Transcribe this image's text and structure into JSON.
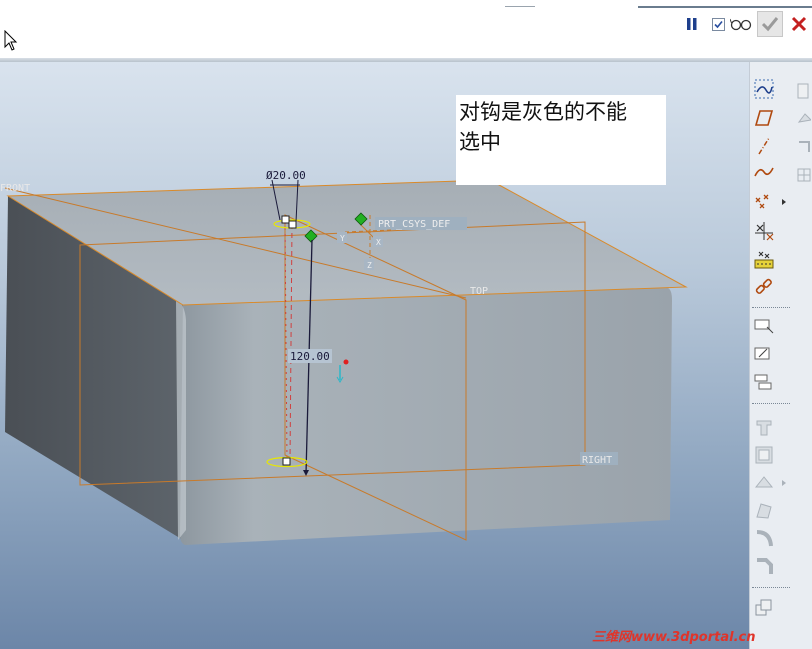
{
  "note": {
    "line1": "对钩是灰色的不能",
    "line2": "选中"
  },
  "datum_labels": {
    "front": "FRONT",
    "top": "TOP",
    "right": "RIGHT",
    "csys": "PRT_CSYS_DEF"
  },
  "dimensions": {
    "diameter": "Ø20.00",
    "length": "120.00"
  },
  "axis_labels": {
    "y": "Y",
    "x": "X",
    "z": "Z"
  },
  "watermark": "三维网www.3dportal.cn",
  "colors": {
    "datum": "#d98a2a",
    "confirm_disabled": "#9a9a9a",
    "cancel": "#c42020",
    "pause": "#1e3f8c",
    "handle_green": "#22b022"
  },
  "toolbar_top": [
    "pause-icon",
    "checkbox-icon",
    "glasses-icon",
    "confirm-checkmark-icon",
    "cancel-x-icon"
  ],
  "right_toolbar": [
    "sketch-icon",
    "plane-icon",
    "axis-icon",
    "curve-icon",
    "point-icon",
    "csys-icon",
    "analysis-icon",
    "chain-icon"
  ]
}
